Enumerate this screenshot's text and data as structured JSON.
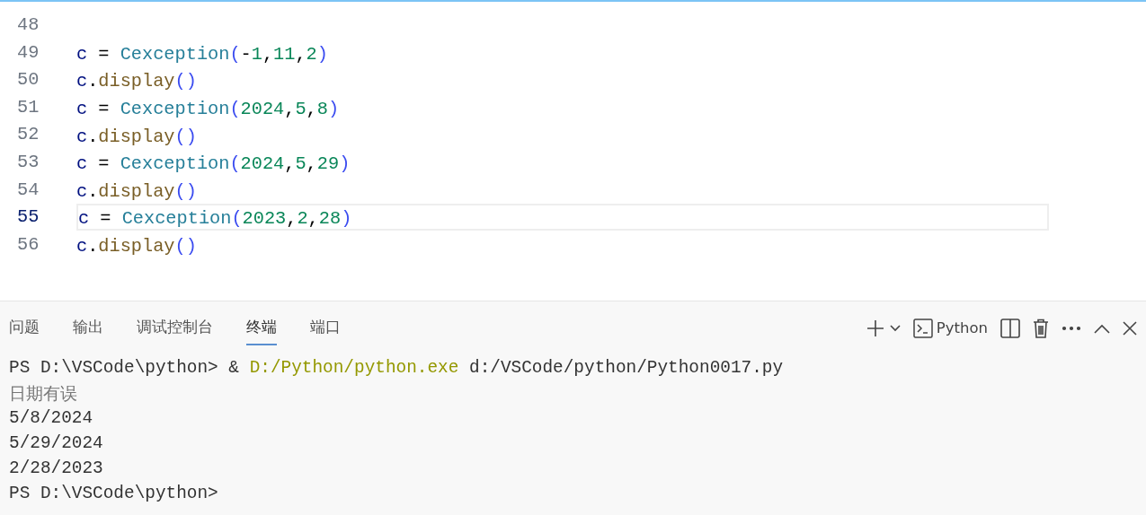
{
  "editor": {
    "lines": [
      {
        "number": "48",
        "current": false
      },
      {
        "number": "49",
        "current": false,
        "tokens": [
          {
            "text": "c",
            "kind": "var"
          },
          {
            "text": " = ",
            "kind": "op"
          },
          {
            "text": "Cexception",
            "kind": "cls"
          },
          {
            "text": "(",
            "kind": "br"
          },
          {
            "text": "-",
            "kind": "op"
          },
          {
            "text": "1",
            "kind": "num"
          },
          {
            "text": ",",
            "kind": "op"
          },
          {
            "text": "11",
            "kind": "num"
          },
          {
            "text": ",",
            "kind": "op"
          },
          {
            "text": "2",
            "kind": "num"
          },
          {
            "text": ")",
            "kind": "br"
          }
        ]
      },
      {
        "number": "50",
        "current": false,
        "tokens": [
          {
            "text": "c",
            "kind": "var"
          },
          {
            "text": ".",
            "kind": "op"
          },
          {
            "text": "display",
            "kind": "fn"
          },
          {
            "text": "()",
            "kind": "br"
          }
        ]
      },
      {
        "number": "51",
        "current": false,
        "tokens": [
          {
            "text": "c",
            "kind": "var"
          },
          {
            "text": " = ",
            "kind": "op"
          },
          {
            "text": "Cexception",
            "kind": "cls"
          },
          {
            "text": "(",
            "kind": "br"
          },
          {
            "text": "2024",
            "kind": "num"
          },
          {
            "text": ",",
            "kind": "op"
          },
          {
            "text": "5",
            "kind": "num"
          },
          {
            "text": ",",
            "kind": "op"
          },
          {
            "text": "8",
            "kind": "num"
          },
          {
            "text": ")",
            "kind": "br"
          }
        ]
      },
      {
        "number": "52",
        "current": false,
        "tokens": [
          {
            "text": "c",
            "kind": "var"
          },
          {
            "text": ".",
            "kind": "op"
          },
          {
            "text": "display",
            "kind": "fn"
          },
          {
            "text": "()",
            "kind": "br"
          }
        ]
      },
      {
        "number": "53",
        "current": false,
        "tokens": [
          {
            "text": "c",
            "kind": "var"
          },
          {
            "text": " = ",
            "kind": "op"
          },
          {
            "text": "Cexception",
            "kind": "cls"
          },
          {
            "text": "(",
            "kind": "br"
          },
          {
            "text": "2024",
            "kind": "num"
          },
          {
            "text": ",",
            "kind": "op"
          },
          {
            "text": "5",
            "kind": "num"
          },
          {
            "text": ",",
            "kind": "op"
          },
          {
            "text": "29",
            "kind": "num"
          },
          {
            "text": ")",
            "kind": "br"
          }
        ]
      },
      {
        "number": "54",
        "current": false,
        "tokens": [
          {
            "text": "c",
            "kind": "var"
          },
          {
            "text": ".",
            "kind": "op"
          },
          {
            "text": "display",
            "kind": "fn"
          },
          {
            "text": "()",
            "kind": "br"
          }
        ]
      },
      {
        "number": "55",
        "current": true,
        "tokens": [
          {
            "text": "c",
            "kind": "var"
          },
          {
            "text": " = ",
            "kind": "op"
          },
          {
            "text": "Cexception",
            "kind": "cls"
          },
          {
            "text": "(",
            "kind": "br"
          },
          {
            "text": "2023",
            "kind": "num"
          },
          {
            "text": ",",
            "kind": "op"
          },
          {
            "text": "2",
            "kind": "num"
          },
          {
            "text": ",",
            "kind": "op"
          },
          {
            "text": "28",
            "kind": "num"
          },
          {
            "text": ")",
            "kind": "br"
          }
        ]
      },
      {
        "number": "56",
        "current": false,
        "tokens": [
          {
            "text": "c",
            "kind": "var"
          },
          {
            "text": ".",
            "kind": "op"
          },
          {
            "text": "display",
            "kind": "fn"
          },
          {
            "text": "()",
            "kind": "br"
          }
        ]
      }
    ]
  },
  "panel": {
    "tabs": [
      {
        "label": "问题",
        "selected": false
      },
      {
        "label": "输出",
        "selected": false
      },
      {
        "label": "调试控制台",
        "selected": false
      },
      {
        "label": "终端",
        "selected": true
      },
      {
        "label": "端口",
        "selected": false
      }
    ],
    "terminal_name": "Python",
    "terminal": [
      {
        "kind": "command",
        "segments": [
          {
            "text": "PS D:\\VSCode\\python> & ",
            "kind": "plain"
          },
          {
            "text": "D:/Python/python.exe",
            "kind": "path"
          },
          {
            "text": " d:/VSCode/python/Python0017.py",
            "kind": "plain"
          }
        ]
      },
      {
        "kind": "error",
        "text": "日期有误"
      },
      {
        "kind": "output",
        "text": "5/8/2024"
      },
      {
        "kind": "output",
        "text": "5/29/2024"
      },
      {
        "kind": "output",
        "text": "2/28/2023"
      },
      {
        "kind": "output",
        "text": "PS D:\\VSCode\\python>"
      }
    ]
  }
}
